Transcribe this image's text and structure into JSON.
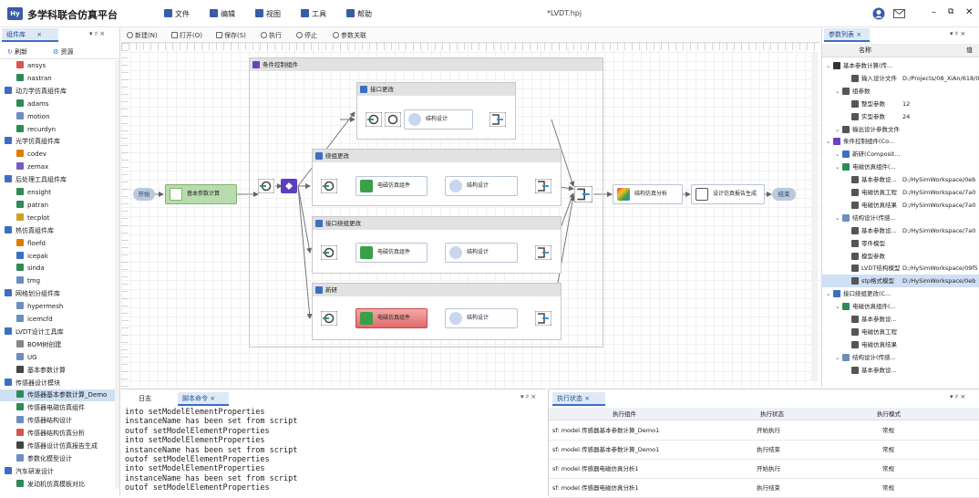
{
  "app": {
    "logo": "Hy",
    "title": "多学科联合仿真平台",
    "document": "*LVDT.hpj"
  },
  "menu": [
    {
      "label": "文件",
      "icon": "file-icon"
    },
    {
      "label": "编辑",
      "icon": "edit-icon"
    },
    {
      "label": "视图",
      "icon": "view-icon"
    },
    {
      "label": "工具",
      "icon": "tools-icon"
    },
    {
      "label": "帮助",
      "icon": "help-icon"
    }
  ],
  "left_panel": {
    "tab": "组件库",
    "refresh": "刷新",
    "resource": "资源",
    "rows": [
      {
        "label": "ansys",
        "kind": "item",
        "color": "#d9534f"
      },
      {
        "label": "nastran",
        "kind": "item",
        "color": "#2e8b57"
      },
      {
        "label": "动力学仿真组件库",
        "kind": "group",
        "color": "#3a6fc4"
      },
      {
        "label": "adams",
        "kind": "item",
        "color": "#2e8b57"
      },
      {
        "label": "motion",
        "kind": "item",
        "color": "#6c8ebf"
      },
      {
        "label": "recurdyn",
        "kind": "item",
        "color": "#2e8b57"
      },
      {
        "label": "光学仿真组件库",
        "kind": "group",
        "color": "#3a6fc4"
      },
      {
        "label": "codev",
        "kind": "item",
        "color": "#e07b00"
      },
      {
        "label": "zemax",
        "kind": "item",
        "color": "#7a5bbf"
      },
      {
        "label": "后处理工具组件库",
        "kind": "group",
        "color": "#3a6fc4"
      },
      {
        "label": "ensight",
        "kind": "item",
        "color": "#2e8b57"
      },
      {
        "label": "patran",
        "kind": "item",
        "color": "#2e8b57"
      },
      {
        "label": "tecplot",
        "kind": "item",
        "color": "#c9a227"
      },
      {
        "label": "热仿真组件库",
        "kind": "group",
        "color": "#3a6fc4"
      },
      {
        "label": "floefd",
        "kind": "item",
        "color": "#e07b00"
      },
      {
        "label": "icepak",
        "kind": "item",
        "color": "#3a6fc4"
      },
      {
        "label": "sinda",
        "kind": "item",
        "color": "#2e8b57"
      },
      {
        "label": "tmg",
        "kind": "item",
        "color": "#6c8ebf"
      },
      {
        "label": "网格划分组件库",
        "kind": "group",
        "color": "#3a6fc4"
      },
      {
        "label": "hypermesh",
        "kind": "item",
        "color": "#6c8ebf"
      },
      {
        "label": "icemcfd",
        "kind": "item",
        "color": "#6c8ebf"
      },
      {
        "label": "LVDT设计工具库",
        "kind": "group",
        "color": "#3a6fc4"
      },
      {
        "label": "BOM树创建",
        "kind": "item",
        "color": "#888"
      },
      {
        "label": "UG",
        "kind": "item",
        "color": "#6c8ebf"
      },
      {
        "label": "基本参数计算",
        "kind": "item",
        "color": "#444"
      },
      {
        "label": "传感器设计模块",
        "kind": "group",
        "color": "#3a6fc4"
      },
      {
        "label": "传感器基本参数计算_Demo",
        "kind": "item",
        "color": "#2e8b57",
        "selected": true
      },
      {
        "label": "传感器电磁仿真组件",
        "kind": "item",
        "color": "#2e8b57"
      },
      {
        "label": "传感器结构设计",
        "kind": "item",
        "color": "#6c8ebf"
      },
      {
        "label": "传感器结构仿真分析",
        "kind": "item",
        "color": "#d9534f"
      },
      {
        "label": "传感器设计仿真报告生成",
        "kind": "item",
        "color": "#444"
      },
      {
        "label": "参数化模型设计",
        "kind": "item",
        "color": "#6c8ebf"
      },
      {
        "label": "汽车研发设计",
        "kind": "group",
        "color": "#3a6fc4"
      },
      {
        "label": "发动机仿真模板对比",
        "kind": "item",
        "color": "#2e8b57"
      }
    ]
  },
  "toolbar": {
    "new": "新建(N)",
    "open": "打开(O)",
    "save": "保存(S)",
    "run": "执行",
    "stop": "停止",
    "param": "参数关联"
  },
  "canvas": {
    "start": "开始",
    "end": "结束",
    "basic_calc": "基本参数计算",
    "outer_container": "条件控制组件",
    "branches": [
      {
        "title": "接口更改",
        "nodes": [
          "结构设计"
        ]
      },
      {
        "title": "绕组更改",
        "nodes": [
          "电磁仿真组件",
          "结构设计"
        ]
      },
      {
        "title": "接口绕组更改",
        "nodes": [
          "电磁仿真组件",
          "结构设计"
        ]
      },
      {
        "title": "新研",
        "nodes": [
          "电磁仿真组件",
          "结构设计"
        ]
      }
    ],
    "analysis": "结构仿真分析",
    "report": "设计仿真报告生成"
  },
  "right_panel": {
    "tab": "参数列表",
    "col_name": "名称",
    "col_value": "值",
    "rows": [
      {
        "name": "基本参数计算(传...",
        "value": "",
        "indent": 0,
        "icon": "#333"
      },
      {
        "name": "输入设计文件",
        "value": "D:/Projects/08_XiAn/618/0",
        "indent": 2,
        "icon": "#555"
      },
      {
        "name": "组参数",
        "value": "",
        "indent": 1,
        "icon": "#555"
      },
      {
        "name": "整型参数",
        "value": "12",
        "indent": 2,
        "icon": "#555"
      },
      {
        "name": "实型参数",
        "value": "24",
        "indent": 2,
        "icon": "#555"
      },
      {
        "name": "输出设计参数文件",
        "value": "",
        "indent": 1,
        "icon": "#555"
      },
      {
        "name": "条件控制组件(Co...",
        "value": "",
        "indent": 0,
        "icon": "#6a3fc4"
      },
      {
        "name": "新研(Composit...",
        "value": "",
        "indent": 1,
        "icon": "#3a6fc4"
      },
      {
        "name": "电磁仿真组件(...",
        "value": "",
        "indent": 1,
        "icon": "#2e8b57"
      },
      {
        "name": "基本参数设...",
        "value": "D:/HySimWorkspace/0eb",
        "indent": 2,
        "icon": "#555"
      },
      {
        "name": "电磁仿真工程",
        "value": "D:/HySimWorkspace/7a0",
        "indent": 2,
        "icon": "#555"
      },
      {
        "name": "电磁仿真结果",
        "value": "D:/HySimWorkspace/7a0",
        "indent": 2,
        "icon": "#555"
      },
      {
        "name": "结构设计(传感...",
        "value": "",
        "indent": 1,
        "icon": "#6c8ebf"
      },
      {
        "name": "基本参数设...",
        "value": "D:/HySimWorkspace/7a0",
        "indent": 2,
        "icon": "#555"
      },
      {
        "name": "零件模型",
        "value": "",
        "indent": 2,
        "icon": "#555"
      },
      {
        "name": "模型参数",
        "value": "",
        "indent": 2,
        "icon": "#555"
      },
      {
        "name": "LVDT结构模型",
        "value": "D:/HySimWorkspace/09f5",
        "indent": 2,
        "icon": "#555"
      },
      {
        "name": "stp格式模型",
        "value": "D:/HySimWorkspace/0eb",
        "indent": 2,
        "icon": "#555",
        "selected": true
      },
      {
        "name": "接口绕组更改(C...",
        "value": "",
        "indent": 0,
        "icon": "#3a6fc4"
      },
      {
        "name": "电磁仿真组件(...",
        "value": "",
        "indent": 1,
        "icon": "#2e8b57"
      },
      {
        "name": "基本参数设...",
        "value": "",
        "indent": 2,
        "icon": "#555"
      },
      {
        "name": "电磁仿真工程",
        "value": "",
        "indent": 2,
        "icon": "#555"
      },
      {
        "name": "电磁仿真结果",
        "value": "",
        "indent": 2,
        "icon": "#555"
      },
      {
        "name": "结构设计(传感...",
        "value": "",
        "indent": 1,
        "icon": "#6c8ebf"
      },
      {
        "name": "基本参数设...",
        "value": "",
        "indent": 2,
        "icon": "#555"
      }
    ]
  },
  "log_panel": {
    "tabs": [
      "日志",
      "脚本命令"
    ],
    "lines": [
      "into setModelElementProperties",
      "instanceName has been set from script",
      "outof setModelElementProperties",
      "into setModelElementProperties",
      "instanceName has been set from script",
      "outof setModelElementProperties",
      "into setModelElementProperties",
      "instanceName has been set from script",
      "outof setModelElementProperties"
    ]
  },
  "status_panel": {
    "tab": "执行状态",
    "columns": [
      "执行组件",
      "执行状态",
      "执行模式"
    ],
    "rows": [
      {
        "component": "sf: model.传感器基本参数计算_Demo1",
        "status": "开始执行",
        "mode": "常规"
      },
      {
        "component": "sf: model.传感器基本参数计算_Demo1",
        "status": "执行结束",
        "mode": "常规"
      },
      {
        "component": "sf: model.传感器电磁仿真分析1",
        "status": "开始执行",
        "mode": "常规"
      },
      {
        "component": "sf: model.传感器电磁仿真分析1",
        "status": "执行结束",
        "mode": "常规"
      }
    ]
  }
}
